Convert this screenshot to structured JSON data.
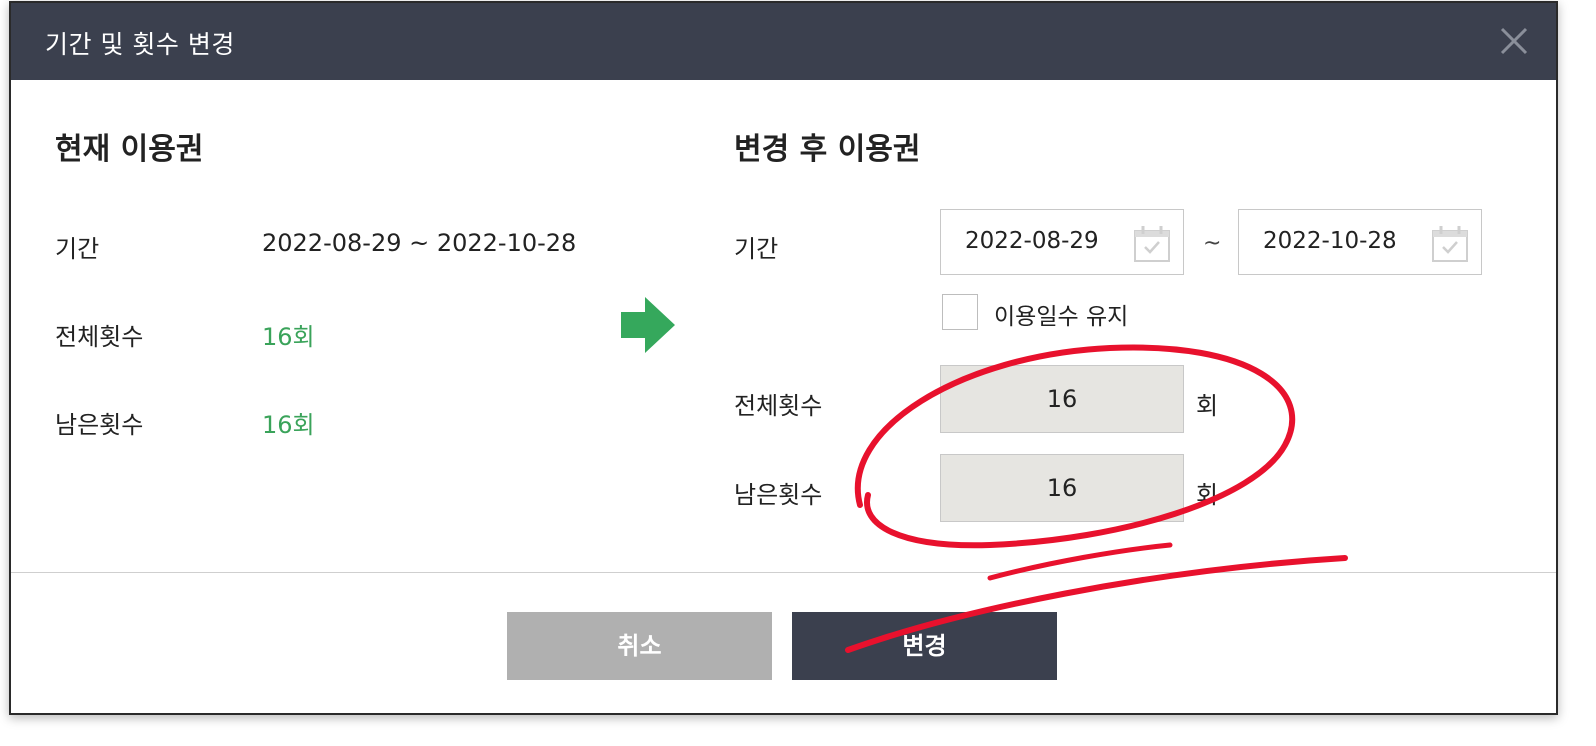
{
  "dialog": {
    "title": "기간 및 횟수 변경",
    "close_icon": "close-icon"
  },
  "current": {
    "title": "현재 이용권",
    "period_label": "기간",
    "period_value": "2022-08-29 ~ 2022-10-28",
    "total_label": "전체횟수",
    "total_value": "16회",
    "remaining_label": "남은횟수",
    "remaining_value": "16회"
  },
  "arrow_icon": "arrow-right-icon",
  "after": {
    "title": "변경 후 이용권",
    "period_label": "기간",
    "start_date": "2022-08-29",
    "separator": "~",
    "end_date": "2022-10-28",
    "calendar_icon": "calendar-icon",
    "keep_days_label": "이용일수 유지",
    "keep_days_checked": false,
    "total_label": "전체횟수",
    "total_value": "16",
    "total_unit": "회",
    "remaining_label": "남은횟수",
    "remaining_value": "16",
    "remaining_unit": "회"
  },
  "buttons": {
    "cancel": "취소",
    "confirm": "변경"
  },
  "colors": {
    "header_bg": "#3b404e",
    "accent_green": "#3aa35a",
    "readonly_input_bg": "#e6e5e1",
    "cancel_bg": "#b0b0b0",
    "annotation_red": "#e8112d"
  }
}
